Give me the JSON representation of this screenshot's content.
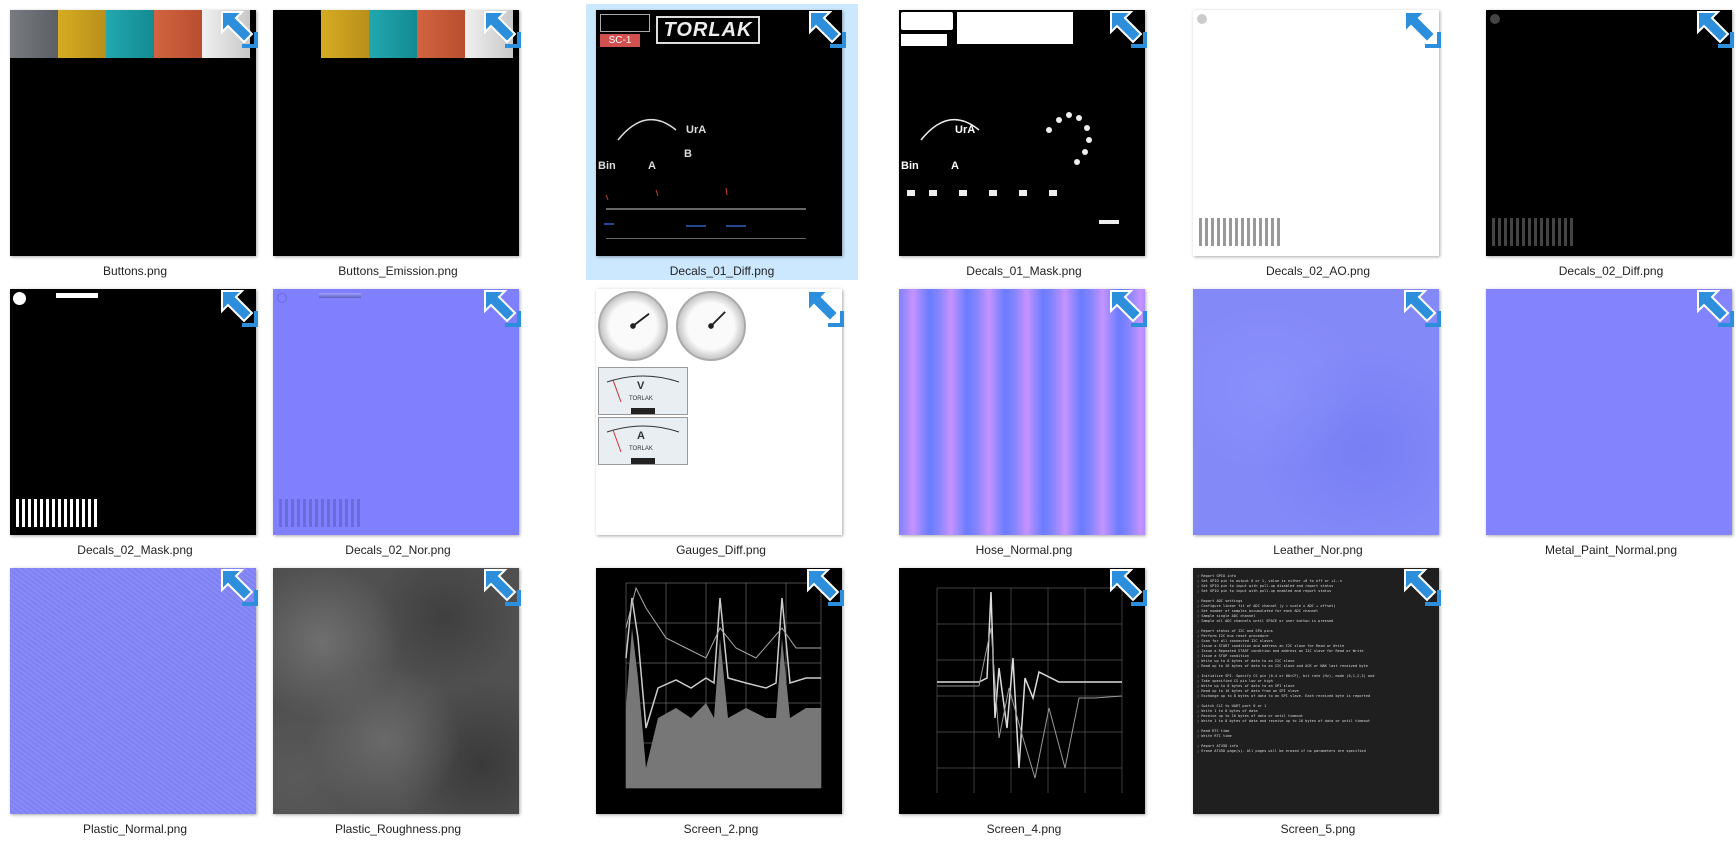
{
  "files": [
    {
      "name": "Buttons.png"
    },
    {
      "name": "Buttons_Emission.png"
    },
    {
      "name": "Decals_01_Diff.png"
    },
    {
      "name": "Decals_01_Mask.png"
    },
    {
      "name": "Decals_02_AO.png"
    },
    {
      "name": "Decals_02_Diff.png"
    },
    {
      "name": "Decals_02_Mask.png"
    },
    {
      "name": "Decals_02_Nor.png"
    },
    {
      "name": "Gauges_Diff.png"
    },
    {
      "name": "Hose_Normal.png"
    },
    {
      "name": "Leather_Nor.png"
    },
    {
      "name": "Metal_Paint_Normal.png"
    },
    {
      "name": "Plastic_Normal.png"
    },
    {
      "name": "Plastic_Roughness.png"
    },
    {
      "name": "Screen_2.png"
    },
    {
      "name": "Screen_4.png"
    },
    {
      "name": "Screen_5.png"
    }
  ],
  "selected_file": "Decals_01_Diff.png",
  "thumb_text": {
    "torlak": "TORLAK",
    "sc1": "SC-1",
    "ura": "UrA",
    "bin": "Bin",
    "a": "A",
    "b": "B",
    "v": "V"
  },
  "colors": {
    "selection": "#cce8ff",
    "shortcut_arrow": "#2d8fdc",
    "swatch_gray": "#6a6e72",
    "swatch_yellow": "#c9a21a",
    "swatch_teal": "#1e9aa2",
    "swatch_orange": "#c85a3a",
    "swatch_white": "#e0e0e0"
  },
  "icons": {
    "shortcut": "shortcut-arrow-icon"
  },
  "terminal_lines": [
    "; Report GPIO info",
    "; Set GPIO pin to output 0 or 1, value is either +0 to off or +1..n",
    "; Set GPIO pin to input with pull-up disabled and report status",
    "; Set GPIO pin to input with pull-up enabled and report status",
    "",
    "; Report ADC settings",
    "; Configure linear fit of ADC channel (y = scale x ADC + offset)",
    "; Set number of samples accumulated for each ADC channel",
    "; Sample single ADC channel",
    "; Sample all ADC channels until SPACE or user button is pressed",
    "",
    "; Report status of I2C and SPA pins",
    "; Perform I2C bus reset procedure",
    "; Scan for all connected I2C slaves",
    "; Issue a START condition and address an I2C slave for Read or Write",
    "; Issue a Repeated START condition and address an I2C slave for Read or Write",
    "; Issue a STOP condition",
    "; Write up to 8 bytes of data to an I2C slave",
    "; Read up to 16 bytes of data to an I2C slave and ACK or NAK last received byte",
    "",
    "; Initialize SPI. Specify CS pin (0-4 or 00=CF), bit rate (Hz), mode (0,1,2,3) and",
    "; Take specified CS pin low or high",
    "; Write up to 8 bytes of data to an SPI slave",
    "; Read up to 16 bytes of data from an SPI slave",
    "; Exchange up to 8 bytes of data to an SPI slave. Each received byte is reported",
    "",
    "; Switch CLI to UART port 0 or 1",
    "; Write 1 to 8 bytes of data",
    "; Receive up to 16 bytes of data or until timeout",
    "; Write 1 to 8 bytes of data and receive up to 16 bytes of data or until timeout",
    "",
    "; Read RTC time",
    "; Write RTC time",
    "",
    "; Report AT45D info",
    "; Erase AT45D page(s). All pages will be erased if no parameters are specified"
  ]
}
